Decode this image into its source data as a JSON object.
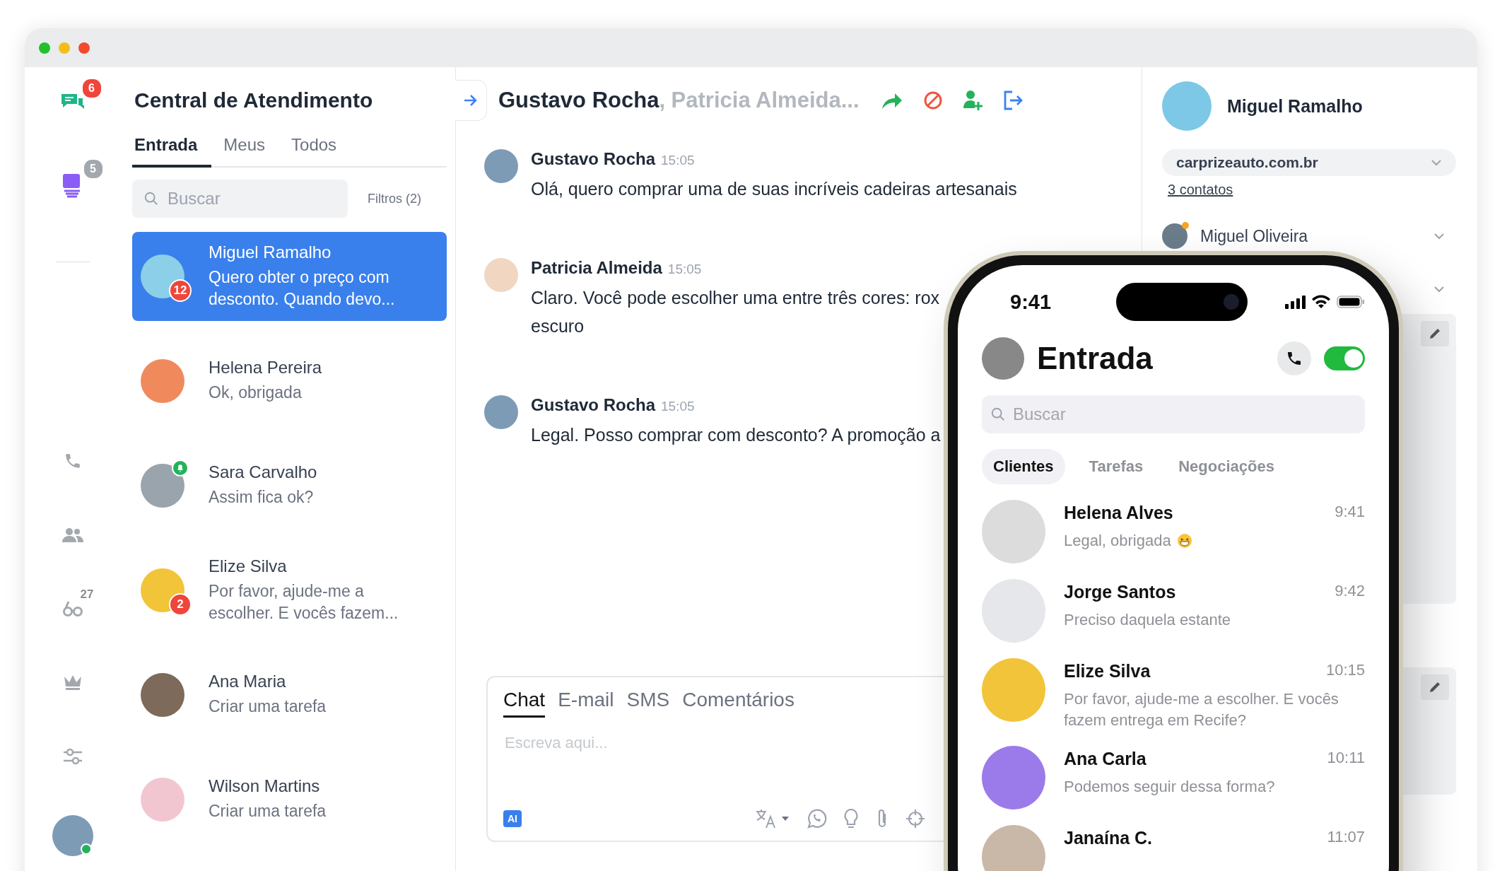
{
  "nav_rail": {
    "items": [
      {
        "kind": "chats",
        "badge": "6"
      },
      {
        "kind": "tasks",
        "badge": "5"
      },
      {
        "kind": "calls"
      },
      {
        "kind": "contacts"
      },
      {
        "kind": "glasses",
        "badge": "27"
      },
      {
        "kind": "crown"
      },
      {
        "kind": "settings"
      }
    ]
  },
  "inbox": {
    "title": "Central de Atendimento",
    "tabs": [
      {
        "label": "Entrada",
        "selected": true
      },
      {
        "label": "Meus",
        "selected": false
      },
      {
        "label": "Todos",
        "selected": false
      }
    ],
    "search": {
      "placeholder": "Buscar"
    },
    "filters": "Filtros (2)",
    "conversations": [
      {
        "name": "Miguel Ramalho",
        "preview": "Quero obter o preço com desconto. Quando devo...",
        "selected": true,
        "badge": "12",
        "alert": false
      },
      {
        "name": "Helena Pereira",
        "preview": "Ok, obrigada",
        "selected": false,
        "alert": false
      },
      {
        "name": "Sara Carvalho",
        "preview": "Assim fica ok?",
        "selected": false,
        "alert": true
      },
      {
        "name": "Elize Silva",
        "preview": "Por favor, ajude-me a escolher. E vocês fazem...",
        "selected": false,
        "badge": "2",
        "alert": false
      },
      {
        "name": "Ana Maria",
        "preview": "Criar uma tarefa",
        "selected": false,
        "alert": false
      },
      {
        "name": "Wilson Martins",
        "preview": "Criar uma tarefa",
        "selected": false,
        "alert": false
      }
    ]
  },
  "chat": {
    "header": {
      "name": "Gustavo Rocha",
      "others": ", Patricia Almeida..."
    },
    "messages": [
      {
        "author": "Gustavo Rocha",
        "time": "15:05",
        "text": "Olá, quero comprar uma de suas incríveis cadeiras artesanais"
      },
      {
        "author": "Patricia Almeida",
        "time": "15:05",
        "text": "Claro. Você pode escolher uma entre três cores: rox",
        "continuation": "escuro"
      },
      {
        "author": "Gustavo Rocha",
        "time": "15:05",
        "text": "Legal. Posso comprar com desconto? A promoção a"
      }
    ],
    "composer": {
      "tabs": [
        {
          "label": "Chat",
          "selected": true
        },
        {
          "label": "E-mail",
          "selected": false
        },
        {
          "label": "SMS",
          "selected": false
        },
        {
          "label": "Comentários",
          "selected": false
        }
      ],
      "placeholder": "Escreva aqui...",
      "ai_label": "AI"
    }
  },
  "contact_panel": {
    "name": "Miguel Ramalho",
    "company": "carprizeauto.com.br",
    "contacts_link": "3 contatos",
    "contacts": [
      {
        "name": "Miguel Oliveira"
      }
    ]
  },
  "phone": {
    "time": "9:41",
    "title": "Entrada",
    "available": true,
    "search": {
      "placeholder": "Buscar"
    },
    "tabs": [
      {
        "label": "Clientes",
        "selected": true
      },
      {
        "label": "Tarefas",
        "selected": false
      },
      {
        "label": "Negociações",
        "selected": false
      }
    ],
    "conversations": [
      {
        "name": "Helena Alves",
        "preview": "Legal, obrigada",
        "emoji": true,
        "time": "9:41"
      },
      {
        "name": "Jorge Santos",
        "preview": "Preciso daquela estante",
        "emoji": false,
        "time": "9:42"
      },
      {
        "name": "Elize Silva",
        "preview": "Por favor, ajude-me a escolher. E vocês fazem entrega em Recife?",
        "emoji": false,
        "time": "10:15"
      },
      {
        "name": "Ana Carla",
        "preview": "Podemos seguir dessa forma?",
        "emoji": false,
        "time": "10:11"
      },
      {
        "name": "Janaína C.",
        "emoji": false,
        "time": "11:07"
      }
    ]
  }
}
